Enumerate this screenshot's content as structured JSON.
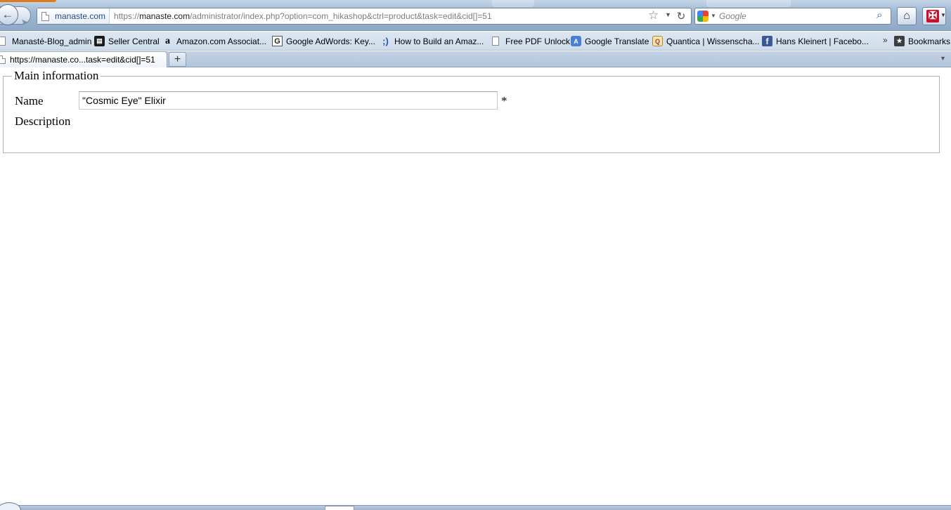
{
  "navbar": {
    "site_domain": "manaste.com",
    "url_prefix": "https://",
    "url_host": "manaste.com",
    "url_path": "/administrator/index.php?option=com_hikashop&ctrl=product&task=edit&cid[]=51",
    "search_placeholder": "Google",
    "back_icon": "back-arrow-icon",
    "forward_icon": "forward-arrow-icon",
    "home_icon": "home-icon"
  },
  "bookmarks": [
    {
      "label": "Manasté-Blog_admin",
      "icon": "page-icon"
    },
    {
      "label": "Seller Central",
      "icon": "book-icon"
    },
    {
      "label": "Amazon.com Associat...",
      "icon": "amazon-icon"
    },
    {
      "label": "Google AdWords: Key...",
      "icon": "google-g-icon"
    },
    {
      "label": "How to Build an Amaz...",
      "icon": "smiley-icon"
    },
    {
      "label": "Free PDF Unlock",
      "icon": "page-icon"
    },
    {
      "label": "Google Translate",
      "icon": "translate-icon"
    },
    {
      "label": "Quantica | Wissenscha...",
      "icon": "quantica-icon"
    },
    {
      "label": "Hans Kleinert | Facebo...",
      "icon": "facebook-icon"
    },
    {
      "label": "Bookmarks",
      "icon": "bookmarks-icon"
    }
  ],
  "tabs": {
    "active_title": "https://manaste.co...task=edit&cid[]=51"
  },
  "form": {
    "legend": "Main information",
    "name_label": "Name",
    "name_value": "\"Cosmic Eye\" Elixir",
    "required_marker": "*",
    "description_label": "Description"
  },
  "colors": {
    "chrome_blue": "#9fb7d2",
    "link_blue": "#1e4b8f",
    "orange_accent": "#e07a1d"
  }
}
